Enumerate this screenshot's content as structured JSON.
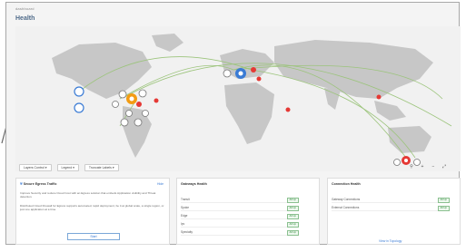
{
  "app": {
    "breadcrumb": "dashboard"
  },
  "page": {
    "title": "Health"
  },
  "map_toolbar": {
    "layers_label": "Layers Control",
    "legend_label": "Legend",
    "truncate_label": "Truncate Labels"
  },
  "zoom": {
    "search": "⚲",
    "zoom_in": "+",
    "zoom_out": "−",
    "fit": "⤢"
  },
  "egress_card": {
    "title": "Secure Egress Traffic",
    "hide": "Hide",
    "paragraph1": "Improve Security and reduce Cloud Cost with an Egress solution that embeds Application visibility and Threat detection.",
    "paragraph2": "Distributed Cloud Firewall for Egress supports automated, rapid deployment, be it at global scale, a single region, or just one application at a time.",
    "start": "Start"
  },
  "gateways_card": {
    "title": "Gateways Health",
    "rows": [
      {
        "label": "Transit",
        "status": "All Up"
      },
      {
        "label": "Spoke",
        "status": "All Up"
      },
      {
        "label": "Edge",
        "status": "All Up"
      },
      {
        "label": "Ipv",
        "status": "All Up"
      },
      {
        "label": "Specialty",
        "status": "All Up"
      }
    ]
  },
  "connection_card": {
    "title": "Connection Health",
    "rows": [
      {
        "label": "Gateway Connections",
        "status": "All Up"
      },
      {
        "label": "External Connections",
        "status": "All Up"
      }
    ],
    "link": "View in Topology"
  },
  "colors": {
    "accent": "#3a7bd5",
    "status_ok": "#2f8a3a",
    "alert": "#e53935",
    "node_orange": "#f39c12"
  }
}
